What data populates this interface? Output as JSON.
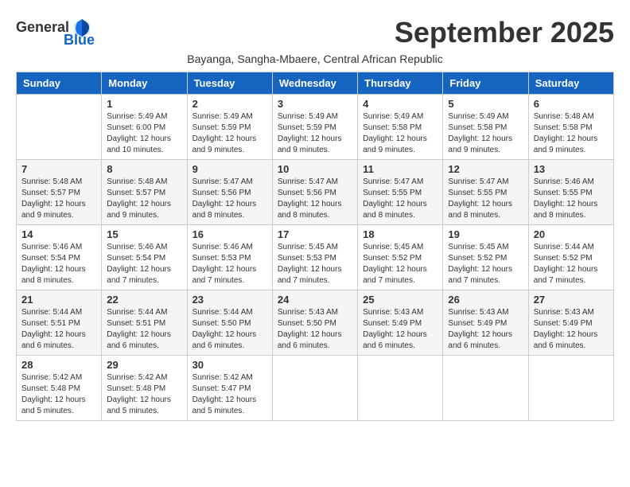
{
  "header": {
    "logo_general": "General",
    "logo_blue": "Blue",
    "month_title": "September 2025",
    "subtitle": "Bayanga, Sangha-Mbaere, Central African Republic"
  },
  "days_of_week": [
    "Sunday",
    "Monday",
    "Tuesday",
    "Wednesday",
    "Thursday",
    "Friday",
    "Saturday"
  ],
  "weeks": [
    [
      {
        "day": "",
        "content": ""
      },
      {
        "day": "1",
        "content": "Sunrise: 5:49 AM\nSunset: 6:00 PM\nDaylight: 12 hours\nand 10 minutes."
      },
      {
        "day": "2",
        "content": "Sunrise: 5:49 AM\nSunset: 5:59 PM\nDaylight: 12 hours\nand 9 minutes."
      },
      {
        "day": "3",
        "content": "Sunrise: 5:49 AM\nSunset: 5:59 PM\nDaylight: 12 hours\nand 9 minutes."
      },
      {
        "day": "4",
        "content": "Sunrise: 5:49 AM\nSunset: 5:58 PM\nDaylight: 12 hours\nand 9 minutes."
      },
      {
        "day": "5",
        "content": "Sunrise: 5:49 AM\nSunset: 5:58 PM\nDaylight: 12 hours\nand 9 minutes."
      },
      {
        "day": "6",
        "content": "Sunrise: 5:48 AM\nSunset: 5:58 PM\nDaylight: 12 hours\nand 9 minutes."
      }
    ],
    [
      {
        "day": "7",
        "content": "Sunrise: 5:48 AM\nSunset: 5:57 PM\nDaylight: 12 hours\nand 9 minutes."
      },
      {
        "day": "8",
        "content": "Sunrise: 5:48 AM\nSunset: 5:57 PM\nDaylight: 12 hours\nand 9 minutes."
      },
      {
        "day": "9",
        "content": "Sunrise: 5:47 AM\nSunset: 5:56 PM\nDaylight: 12 hours\nand 8 minutes."
      },
      {
        "day": "10",
        "content": "Sunrise: 5:47 AM\nSunset: 5:56 PM\nDaylight: 12 hours\nand 8 minutes."
      },
      {
        "day": "11",
        "content": "Sunrise: 5:47 AM\nSunset: 5:55 PM\nDaylight: 12 hours\nand 8 minutes."
      },
      {
        "day": "12",
        "content": "Sunrise: 5:47 AM\nSunset: 5:55 PM\nDaylight: 12 hours\nand 8 minutes."
      },
      {
        "day": "13",
        "content": "Sunrise: 5:46 AM\nSunset: 5:55 PM\nDaylight: 12 hours\nand 8 minutes."
      }
    ],
    [
      {
        "day": "14",
        "content": "Sunrise: 5:46 AM\nSunset: 5:54 PM\nDaylight: 12 hours\nand 8 minutes."
      },
      {
        "day": "15",
        "content": "Sunrise: 5:46 AM\nSunset: 5:54 PM\nDaylight: 12 hours\nand 7 minutes."
      },
      {
        "day": "16",
        "content": "Sunrise: 5:46 AM\nSunset: 5:53 PM\nDaylight: 12 hours\nand 7 minutes."
      },
      {
        "day": "17",
        "content": "Sunrise: 5:45 AM\nSunset: 5:53 PM\nDaylight: 12 hours\nand 7 minutes."
      },
      {
        "day": "18",
        "content": "Sunrise: 5:45 AM\nSunset: 5:52 PM\nDaylight: 12 hours\nand 7 minutes."
      },
      {
        "day": "19",
        "content": "Sunrise: 5:45 AM\nSunset: 5:52 PM\nDaylight: 12 hours\nand 7 minutes."
      },
      {
        "day": "20",
        "content": "Sunrise: 5:44 AM\nSunset: 5:52 PM\nDaylight: 12 hours\nand 7 minutes."
      }
    ],
    [
      {
        "day": "21",
        "content": "Sunrise: 5:44 AM\nSunset: 5:51 PM\nDaylight: 12 hours\nand 6 minutes."
      },
      {
        "day": "22",
        "content": "Sunrise: 5:44 AM\nSunset: 5:51 PM\nDaylight: 12 hours\nand 6 minutes."
      },
      {
        "day": "23",
        "content": "Sunrise: 5:44 AM\nSunset: 5:50 PM\nDaylight: 12 hours\nand 6 minutes."
      },
      {
        "day": "24",
        "content": "Sunrise: 5:43 AM\nSunset: 5:50 PM\nDaylight: 12 hours\nand 6 minutes."
      },
      {
        "day": "25",
        "content": "Sunrise: 5:43 AM\nSunset: 5:49 PM\nDaylight: 12 hours\nand 6 minutes."
      },
      {
        "day": "26",
        "content": "Sunrise: 5:43 AM\nSunset: 5:49 PM\nDaylight: 12 hours\nand 6 minutes."
      },
      {
        "day": "27",
        "content": "Sunrise: 5:43 AM\nSunset: 5:49 PM\nDaylight: 12 hours\nand 6 minutes."
      }
    ],
    [
      {
        "day": "28",
        "content": "Sunrise: 5:42 AM\nSunset: 5:48 PM\nDaylight: 12 hours\nand 5 minutes."
      },
      {
        "day": "29",
        "content": "Sunrise: 5:42 AM\nSunset: 5:48 PM\nDaylight: 12 hours\nand 5 minutes."
      },
      {
        "day": "30",
        "content": "Sunrise: 5:42 AM\nSunset: 5:47 PM\nDaylight: 12 hours\nand 5 minutes."
      },
      {
        "day": "",
        "content": ""
      },
      {
        "day": "",
        "content": ""
      },
      {
        "day": "",
        "content": ""
      },
      {
        "day": "",
        "content": ""
      }
    ]
  ]
}
